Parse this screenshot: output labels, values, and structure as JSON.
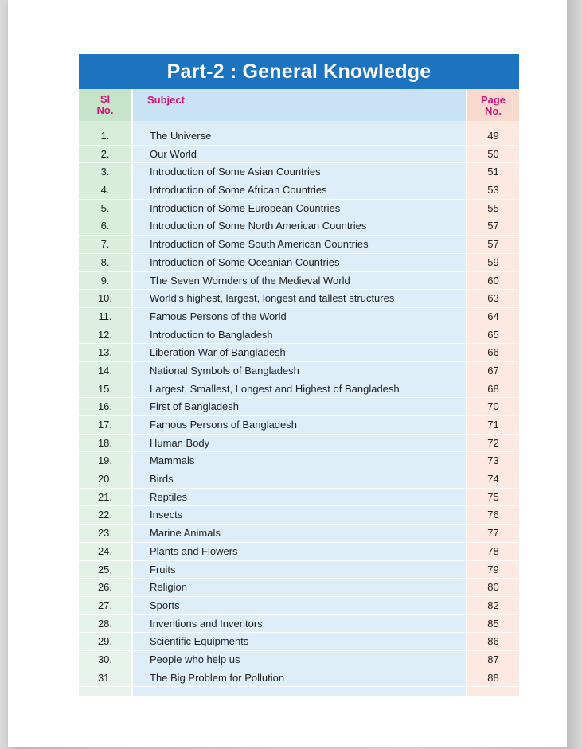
{
  "title": "Part-2 : General Knowledge",
  "headers": {
    "sl": "Sl No.",
    "subject": "Subject",
    "page": "Page No."
  },
  "rows": [
    {
      "num": "1.",
      "subject": "The Universe",
      "page": "49"
    },
    {
      "num": "2.",
      "subject": "Our World",
      "page": "50"
    },
    {
      "num": "3.",
      "subject": "Introduction of Some Asian Countries",
      "page": "51"
    },
    {
      "num": "4.",
      "subject": "Introduction of Some African Countries",
      "page": "53"
    },
    {
      "num": "5.",
      "subject": "Introduction of Some European Countries",
      "page": "55"
    },
    {
      "num": "6.",
      "subject": "Introduction of Some North American Countries",
      "page": "57"
    },
    {
      "num": "7.",
      "subject": "Introduction of Some South American Countries",
      "page": "57"
    },
    {
      "num": "8.",
      "subject": "Introduction of Some Oceanian Countries",
      "page": "59"
    },
    {
      "num": "9.",
      "subject": "The Seven Wornders of the Medieval World",
      "page": "60"
    },
    {
      "num": "10.",
      "subject": "World’s highest, largest, longest and tallest structures",
      "page": "63"
    },
    {
      "num": "11.",
      "subject": "Famous Persons of the World",
      "page": "64"
    },
    {
      "num": "12.",
      "subject": "Introduction to Bangladesh",
      "page": "65"
    },
    {
      "num": "13.",
      "subject": "Liberation War of Bangladesh",
      "page": "66"
    },
    {
      "num": "14.",
      "subject": "National Symbols of Bangladesh",
      "page": "67"
    },
    {
      "num": "15.",
      "subject": "Largest, Smallest, Longest and Highest of Bangladesh",
      "page": "68"
    },
    {
      "num": "16.",
      "subject": "First of Bangladesh",
      "page": "70"
    },
    {
      "num": "17.",
      "subject": "Famous Persons of Bangladesh",
      "page": "71"
    },
    {
      "num": "18.",
      "subject": "Human Body",
      "page": "72"
    },
    {
      "num": "19.",
      "subject": "Mammals",
      "page": "73"
    },
    {
      "num": "20.",
      "subject": "Birds",
      "page": "74"
    },
    {
      "num": "21.",
      "subject": "Reptiles",
      "page": "75"
    },
    {
      "num": "22.",
      "subject": "Insects",
      "page": "76"
    },
    {
      "num": "23.",
      "subject": "Marine Animals",
      "page": "77"
    },
    {
      "num": "24.",
      "subject": "Plants and Flowers",
      "page": "78"
    },
    {
      "num": "25.",
      "subject": "Fruits",
      "page": "79"
    },
    {
      "num": "26.",
      "subject": "Religion",
      "page": "80"
    },
    {
      "num": "27.",
      "subject": "Sports",
      "page": "82"
    },
    {
      "num": "28.",
      "subject": "Inventions and Inventors",
      "page": "85"
    },
    {
      "num": "29.",
      "subject": "Scientific Equipments",
      "page": "86"
    },
    {
      "num": "30.",
      "subject": "People who help us",
      "page": "87"
    },
    {
      "num": "31.",
      "subject": "The Big Problem for Pollution",
      "page": "88"
    }
  ],
  "colors": {
    "title_bar": "#1c74c0",
    "header_text": "#d6157a",
    "sl_column": "#d6ecd8",
    "subject_column": "#deeef8",
    "page_column": "#fbe9e2"
  }
}
